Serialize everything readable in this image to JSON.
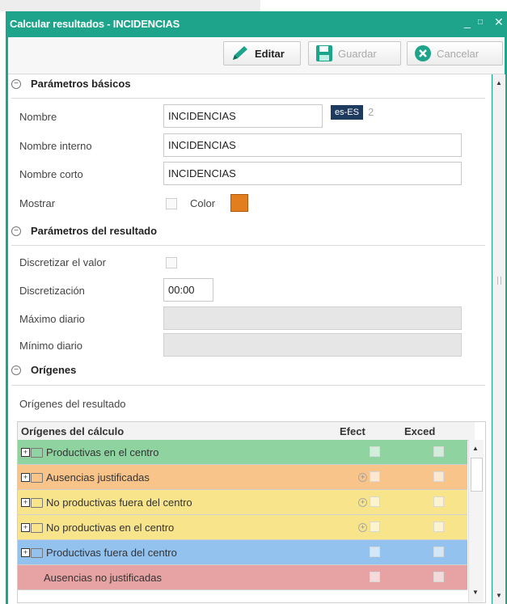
{
  "window": {
    "title": "Calcular resultados - INCIDENCIAS",
    "min_glyph": "_",
    "max_glyph": "□",
    "close_glyph": "✕"
  },
  "toolbar": {
    "edit_label": "Editar",
    "save_label": "Guardar",
    "cancel_label": "Cancelar"
  },
  "basic": {
    "section_title": "Parámetros básicos",
    "nombre_label": "Nombre",
    "nombre_value": "INCIDENCIAS",
    "lang_badge": "es-ES",
    "lang_count": "2",
    "nombre_interno_label": "Nombre interno",
    "nombre_interno_value": "INCIDENCIAS",
    "nombre_corto_label": "Nombre corto",
    "nombre_corto_value": "INCIDENCIAS",
    "mostrar_label": "Mostrar",
    "color_label": "Color",
    "color_value": "#e37e1f"
  },
  "result": {
    "section_title": "Parámetros del resultado",
    "discretizar_label": "Discretizar el valor",
    "discretizacion_label": "Discretización",
    "discretizacion_value": "00:00",
    "maximo_label": "Máximo diario",
    "minimo_label": "Mínimo diario"
  },
  "origins": {
    "section_title": "Orígenes",
    "subtitle": "Orígenes del resultado",
    "columns": {
      "name": "Orígenes del cálculo",
      "efect": "Efect",
      "exced": "Exced"
    },
    "rows": [
      {
        "label": "Productivas en el centro",
        "bg": "#8fd3a1",
        "folder": "#8fd3a1",
        "icons": false
      },
      {
        "label": "Ausencias justificadas",
        "bg": "#f8c48a",
        "folder": "#f8c48a",
        "icons": true
      },
      {
        "label": "No productivas fuera del centro",
        "bg": "#f8e48a",
        "folder": "#f8e48a",
        "icons": true
      },
      {
        "label": "No productivas en el centro",
        "bg": "#f8e48a",
        "folder": "#f8e48a",
        "icons": true
      },
      {
        "label": "Productivas fuera del centro",
        "bg": "#93c2ef",
        "folder": "#93c2ef",
        "icons": false
      },
      {
        "label": "Ausencias no justificadas",
        "bg": "#e7a3a3",
        "folder": "",
        "icons": false
      }
    ]
  }
}
